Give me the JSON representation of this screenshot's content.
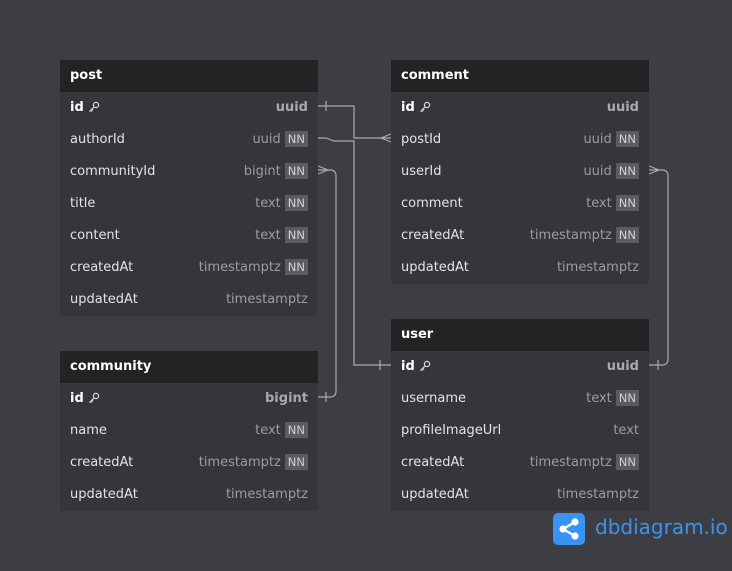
{
  "tables": {
    "post": {
      "name": "post",
      "fields": [
        {
          "name": "id",
          "type": "uuid",
          "pk": true,
          "nn": false
        },
        {
          "name": "authorId",
          "type": "uuid",
          "pk": false,
          "nn": true
        },
        {
          "name": "communityId",
          "type": "bigint",
          "pk": false,
          "nn": true
        },
        {
          "name": "title",
          "type": "text",
          "pk": false,
          "nn": true
        },
        {
          "name": "content",
          "type": "text",
          "pk": false,
          "nn": true
        },
        {
          "name": "createdAt",
          "type": "timestamptz",
          "pk": false,
          "nn": true
        },
        {
          "name": "updatedAt",
          "type": "timestamptz",
          "pk": false,
          "nn": false
        }
      ]
    },
    "comment": {
      "name": "comment",
      "fields": [
        {
          "name": "id",
          "type": "uuid",
          "pk": true,
          "nn": false
        },
        {
          "name": "postId",
          "type": "uuid",
          "pk": false,
          "nn": true
        },
        {
          "name": "userId",
          "type": "uuid",
          "pk": false,
          "nn": true
        },
        {
          "name": "comment",
          "type": "text",
          "pk": false,
          "nn": true
        },
        {
          "name": "createdAt",
          "type": "timestamptz",
          "pk": false,
          "nn": true
        },
        {
          "name": "updatedAt",
          "type": "timestamptz",
          "pk": false,
          "nn": false
        }
      ]
    },
    "community": {
      "name": "community",
      "fields": [
        {
          "name": "id",
          "type": "bigint",
          "pk": true,
          "nn": false
        },
        {
          "name": "name",
          "type": "text",
          "pk": false,
          "nn": true
        },
        {
          "name": "createdAt",
          "type": "timestamptz",
          "pk": false,
          "nn": true
        },
        {
          "name": "updatedAt",
          "type": "timestamptz",
          "pk": false,
          "nn": false
        }
      ]
    },
    "user": {
      "name": "user",
      "fields": [
        {
          "name": "id",
          "type": "uuid",
          "pk": true,
          "nn": false
        },
        {
          "name": "username",
          "type": "text",
          "pk": false,
          "nn": true
        },
        {
          "name": "profileImageUrl",
          "type": "text",
          "pk": false,
          "nn": false
        },
        {
          "name": "createdAt",
          "type": "timestamptz",
          "pk": false,
          "nn": true
        },
        {
          "name": "updatedAt",
          "type": "timestamptz",
          "pk": false,
          "nn": false
        }
      ]
    }
  },
  "nn_label": "NN",
  "pk_icon": "key-icon",
  "brand": {
    "name": "dbdiagram.io",
    "icon": "share-graph-icon",
    "color": "#3a93f2"
  },
  "colors": {
    "background": "#3d3e44",
    "table_body": "#35363c",
    "table_header": "#222325",
    "connector": "#a9aaae"
  }
}
